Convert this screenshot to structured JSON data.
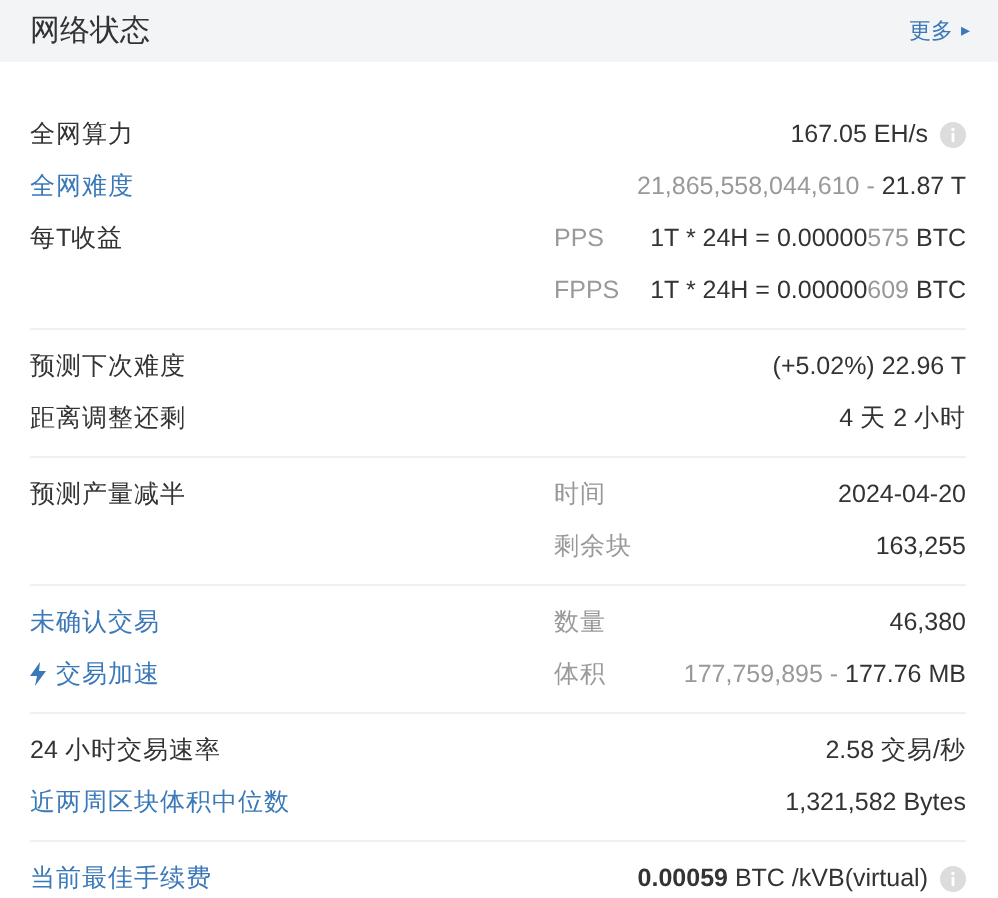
{
  "header": {
    "title": "网络状态",
    "more_link": "更多",
    "more_arrow": "▸"
  },
  "sections": [
    {
      "rows": [
        {
          "label": "全网算力",
          "kind": "plain",
          "value": [
            {
              "text": "167.05 EH/s",
              "muted": false
            }
          ],
          "info": true
        },
        {
          "label": "全网难度",
          "kind": "link",
          "value": [
            {
              "text": "21,865,558,044,610 - ",
              "muted": true
            },
            {
              "text": "21.87 T",
              "muted": false
            }
          ]
        },
        {
          "label": "每T收益",
          "kind": "plain",
          "sublabel": "PPS",
          "value": [
            {
              "text": "1T * 24H = 0.00000",
              "muted": false
            },
            {
              "text": "575",
              "muted": true
            },
            {
              "text": " BTC",
              "muted": false
            }
          ]
        },
        {
          "kind": "plain",
          "sublabel": "FPPS",
          "value": [
            {
              "text": "1T * 24H = 0.00000",
              "muted": false
            },
            {
              "text": "609",
              "muted": true
            },
            {
              "text": " BTC",
              "muted": false
            }
          ]
        }
      ]
    },
    {
      "rows": [
        {
          "label": "预测下次难度",
          "kind": "plain",
          "value": [
            {
              "text": "(+5.02%) 22.96 T",
              "muted": false
            }
          ]
        },
        {
          "label": "距离调整还剩",
          "kind": "plain",
          "value": [
            {
              "text": "4 天 2 小时",
              "muted": false
            }
          ]
        }
      ]
    },
    {
      "rows": [
        {
          "label": "预测产量减半",
          "kind": "plain",
          "sublabel": "时间",
          "value": [
            {
              "text": "2024-04-20",
              "muted": false
            }
          ]
        },
        {
          "kind": "plain",
          "sublabel": "剩余块",
          "value": [
            {
              "text": "163,255",
              "muted": false
            }
          ]
        }
      ]
    },
    {
      "rows": [
        {
          "label": "未确认交易",
          "kind": "link",
          "sublabel": "数量",
          "value": [
            {
              "text": "46,380",
              "muted": false
            }
          ]
        },
        {
          "label": "交易加速",
          "kind": "bolt-link",
          "sublabel": "体积",
          "value": [
            {
              "text": "177,759,895 - ",
              "muted": true
            },
            {
              "text": "177.76 MB",
              "muted": false
            }
          ]
        }
      ]
    },
    {
      "rows": [
        {
          "label": "24 小时交易速率",
          "kind": "plain",
          "value": [
            {
              "text": "2.58 交易/秒",
              "muted": false
            }
          ]
        },
        {
          "label": "近两周区块体积中位数",
          "kind": "link",
          "value": [
            {
              "text": "1,321,582 Bytes",
              "muted": false
            }
          ]
        }
      ]
    },
    {
      "rows": [
        {
          "label": "当前最佳手续费",
          "kind": "link",
          "value": [
            {
              "text": "**0.00059** BTC /kVB(virtual)",
              "muted": false
            }
          ],
          "info": true
        }
      ]
    }
  ]
}
